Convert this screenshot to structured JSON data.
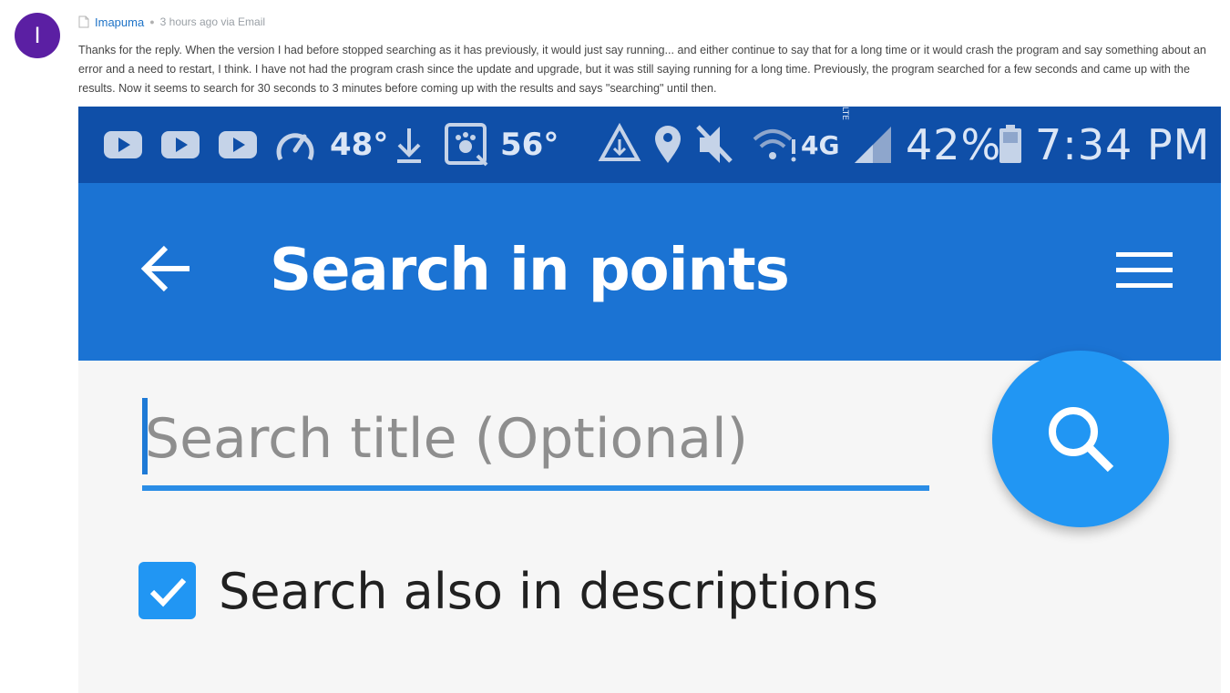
{
  "comment": {
    "avatar_letter": "I",
    "author": "Imapuma",
    "time": "3 hours ago via Email",
    "body": "Thanks for the reply. When the version I had before stopped searching as it has previously, it would just say running... and either continue to say that for a long time or it would crash the program and say something about an error and a need to restart, I think. I have not had the program crash since the update and upgrade, but it was still saying running for a long time. Previously, the program searched for a few seconds and came up with the results. Now it seems to search for 30 seconds to 3 minutes before coming up with the results and says \"searching\" until then."
  },
  "status_bar": {
    "speed_temp": "48°",
    "weather_temp": "56°",
    "network": "4G",
    "network_sub": "LTE",
    "battery": "42%",
    "time": "7:34 PM",
    "icons": [
      "youtube-icon",
      "youtube-icon",
      "youtube-icon",
      "speedometer-icon",
      "download-icon",
      "paw-app-icon",
      "recycle-icon",
      "location-pin-icon",
      "mute-icon",
      "wifi-icon",
      "signal-icon",
      "battery-icon"
    ]
  },
  "app": {
    "title": "Search in points",
    "search_placeholder": "Search title (Optional)",
    "checkbox_label": "Search also in descriptions",
    "checkbox_checked": true
  },
  "colors": {
    "status_bar": "#0f4fa8",
    "app_bar": "#1b73d3",
    "accent": "#2196f3",
    "avatar": "#5b1fa3"
  }
}
